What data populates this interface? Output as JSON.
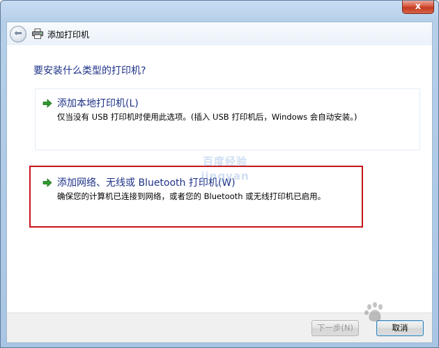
{
  "window": {
    "title": "添加打印机",
    "close_glyph": "x"
  },
  "nav": {
    "back_glyph": "⬅"
  },
  "main": {
    "question": "要安装什么类型的打印机?",
    "options": [
      {
        "title": "添加本地打印机(L)",
        "description": "仅当没有 USB 打印机时使用此选项。(插入 USB 打印机后，Windows 会自动安装。)"
      },
      {
        "title": "添加网络、无线或 Bluetooth 打印机(W)",
        "description": "确保您的计算机已连接到网络，或者您的 Bluetooth 或无线打印机已启用。"
      }
    ]
  },
  "footer": {
    "next_label": "下一步(N)",
    "cancel_label": "取消"
  },
  "watermark": {
    "line1": "百度经验",
    "line2": "jingyan"
  },
  "colors": {
    "link_blue": "#1e3287",
    "highlight_red": "#c8141a",
    "arrow_green": "#2e9a2e"
  }
}
